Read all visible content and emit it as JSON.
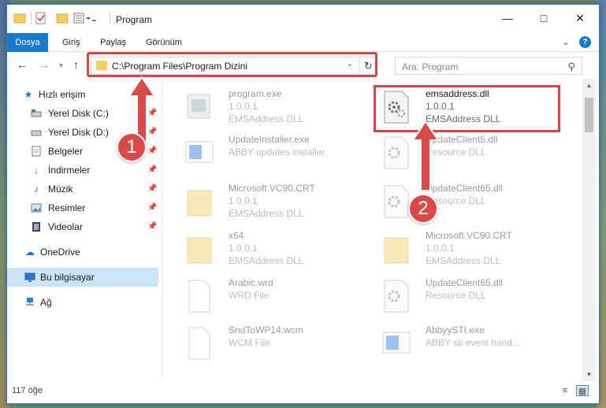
{
  "window": {
    "title": "Program"
  },
  "ribbon": {
    "tabs": [
      "Dosya",
      "Giriş",
      "Paylaş",
      "Görünüm"
    ],
    "help": "?"
  },
  "nav": {
    "address": "C:\\Program Files\\Program Dizini",
    "search_placeholder": "Ara: Program"
  },
  "sidebar": {
    "items": [
      {
        "label": "Hızlı erişim",
        "icon": "star-icon"
      },
      {
        "label": "Yerel Disk (C:)",
        "icon": "drive-icon"
      },
      {
        "label": "Yerel Disk (D:)",
        "icon": "drive-icon"
      },
      {
        "label": "Belgeler",
        "icon": "documents-icon"
      },
      {
        "label": "İndirmeler",
        "icon": "download-icon"
      },
      {
        "label": "Müzik",
        "icon": "music-icon"
      },
      {
        "label": "Resimler",
        "icon": "pictures-icon"
      },
      {
        "label": "Videolar",
        "icon": "video-icon"
      },
      {
        "label": "OneDrive",
        "icon": "cloud-icon"
      },
      {
        "label": "Bu bilgisayar",
        "icon": "computer-icon"
      },
      {
        "label": "Ağ",
        "icon": "network-icon"
      }
    ]
  },
  "files": [
    {
      "name": "program.exe",
      "line2": "1.0.0.1",
      "line3": "EMSAddress DLL",
      "icon": "exe-icon"
    },
    {
      "name": "emsaddress.dll",
      "line2": "1.0.0.1",
      "line3": "EMSAddress DLL",
      "icon": "dll-gear-icon"
    },
    {
      "name": "UpdateInstaller.exe",
      "line2": "ABBY updates installer",
      "line3": "",
      "icon": "exe-icon"
    },
    {
      "name": "UpdateClient5.dll",
      "line2": "Resource DLL",
      "line3": "",
      "icon": "dll-gear-icon"
    },
    {
      "name": "Microsoft.VC90.CRT",
      "line2": "1.0.0.1",
      "line3": "EMSAddress DLL",
      "icon": "folder-icon"
    },
    {
      "name": "UpdateClient65.dll",
      "line2": "Resource DLL",
      "line3": "",
      "icon": "dll-gear-icon"
    },
    {
      "name": "x64",
      "line2": "1.0.0.1",
      "line3": "EMSAddress DLL",
      "icon": "folder-icon"
    },
    {
      "name": "Microsoft.VC90.CRT",
      "line2": "1.0.0.1",
      "line3": "EMSAddress DLL",
      "icon": "folder-icon"
    },
    {
      "name": "Arabic.wrd",
      "line2": "WRD File",
      "line3": "",
      "icon": "file-icon"
    },
    {
      "name": "UpdateClient65.dll",
      "line2": "Resource DLL",
      "line3": "",
      "icon": "dll-gear-icon"
    },
    {
      "name": "SndToWP14.wcm",
      "line2": "WCM File",
      "line3": "",
      "icon": "file-icon"
    },
    {
      "name": "AbbyySTI.exe",
      "line2": "ABBY sti event hand...",
      "line3": "",
      "icon": "exe-icon"
    }
  ],
  "status": {
    "count": "117 öğe"
  },
  "annotations": {
    "step1": "1",
    "step2": "2"
  },
  "colors": {
    "accent": "#1979ca",
    "highlight": "#d64545",
    "folder": "#f3cf62"
  }
}
